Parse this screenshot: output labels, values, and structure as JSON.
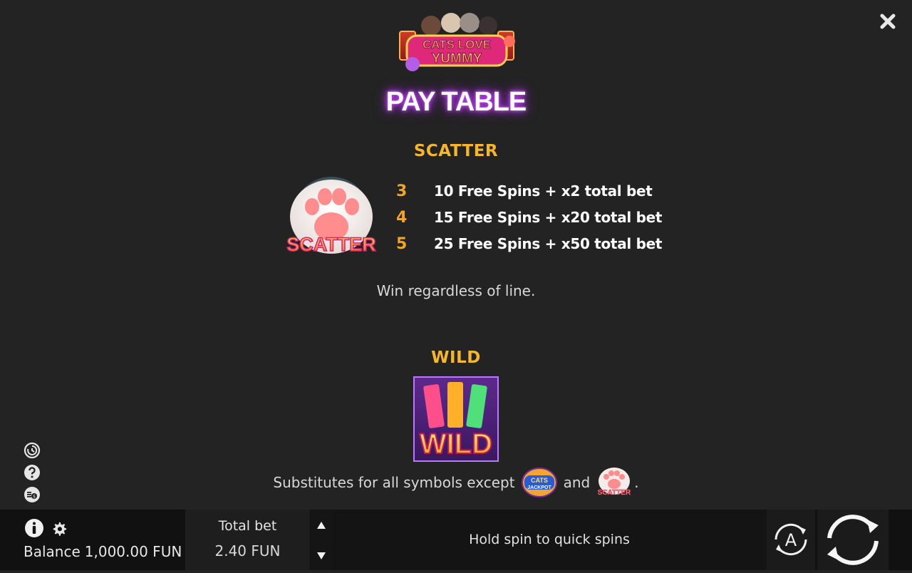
{
  "header": {
    "logo_text_top": "CATS LOVE",
    "logo_text_bottom": "YUMMY",
    "title": "PAY TABLE"
  },
  "scatter": {
    "heading": "SCATTER",
    "symbol_text": "SCATTER",
    "payouts": [
      {
        "count": "3",
        "desc": "10 Free Spins + x2 total bet"
      },
      {
        "count": "4",
        "desc": "15 Free Spins + x20 total bet"
      },
      {
        "count": "5",
        "desc": "25 Free Spins + x50 total bet"
      }
    ],
    "note": "Win regardless of line."
  },
  "wild": {
    "heading": "WILD",
    "symbol_text": "WILD",
    "subs_prefix": "Substitutes for all symbols except",
    "subs_and": "and",
    "subs_suffix": ".",
    "jackpot_icon_top": "CATS",
    "jackpot_icon_bottom": "JACKPOT",
    "scatter_icon_text": "SCATTER"
  },
  "bottom_bar": {
    "balance_label": "Balance",
    "balance_value": "1,000.00 FUN",
    "bet_label": "Total bet",
    "bet_value": "2.40 FUN",
    "message": "Hold spin to quick spins",
    "autoplay_letter": "A"
  },
  "colors": {
    "accent": "#f5b52c",
    "count": "#f0a52a",
    "background": "#232323",
    "title_glow": "#c236ff"
  }
}
